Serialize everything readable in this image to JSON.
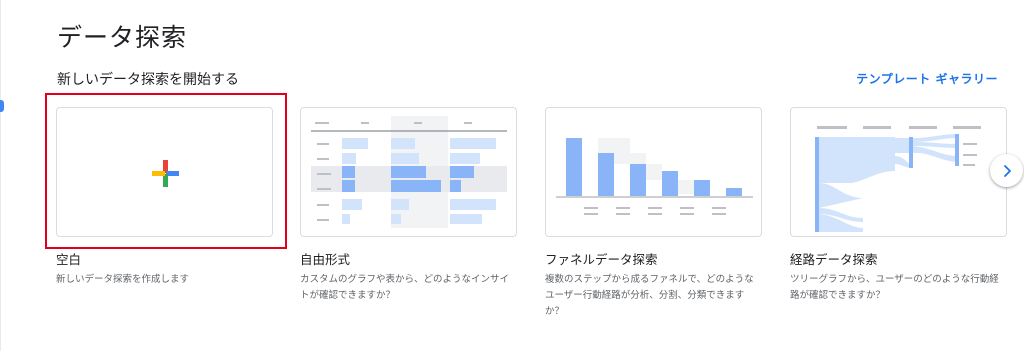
{
  "page": {
    "title": "データ探索",
    "section_title": "新しいデータ探索を開始する",
    "gallery_link": "テンプレート ギャラリー"
  },
  "cards": [
    {
      "name": "空白",
      "description": "新しいデータ探索を作成します"
    },
    {
      "name": "自由形式",
      "description": "カスタムのグラフや表から、どのようなインサイトが確認できますか？"
    },
    {
      "name": "ファネルデータ探索",
      "description": "複数のステップから成るファネルで、どのようなユーザー行動経路が分析、分割、分類できますか？"
    },
    {
      "name": "経路データ探索",
      "description": "ツリーグラフから、ユーザーのどのような行動経路が確認できますか？"
    }
  ],
  "icons": {
    "blank": "plus-icon",
    "next": "chevron-right-icon"
  },
  "colors": {
    "accent": "#1a73e8",
    "selection": "#e0001b",
    "plus_red": "#ea4335",
    "plus_blue": "#4285f4",
    "plus_yellow": "#fbbc04",
    "plus_green": "#34a853",
    "chart_blue": "#8ab4f8",
    "chart_light": "#d2e3fc"
  }
}
